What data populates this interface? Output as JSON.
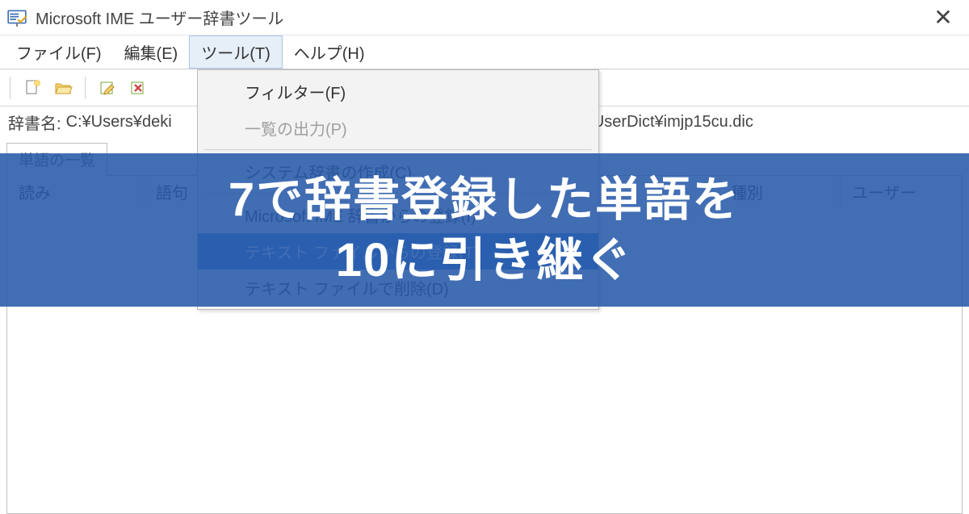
{
  "window": {
    "title": "Microsoft IME ユーザー辞書ツール",
    "close": "✕"
  },
  "menubar": {
    "file": "ファイル(F)",
    "edit": "編集(E)",
    "tools": "ツール(T)",
    "help": "ヘルプ(H)"
  },
  "dropdown": {
    "filter": "フィルター(F)",
    "export": "一覧の出力(P)",
    "create_sys": "システム辞書の作成(C)",
    "import_ime": "Microsoft IME 辞書からの登録(I)",
    "import_text": "テキスト ファイルからの登録(T)",
    "delete_text": "テキスト ファイルで削除(D)"
  },
  "path": {
    "label": "辞書名:",
    "left": "C:¥Users¥deki",
    "right": "¥UserDict¥imjp15cu.dic"
  },
  "tab": {
    "label": "単語の一覧"
  },
  "columns": {
    "reading": "読み",
    "word": "語句",
    "type": "種別",
    "usercomment": "ユーザー"
  },
  "overlay": {
    "line1": "7で辞書登録した単語を",
    "line2": "10に引き継ぐ"
  }
}
